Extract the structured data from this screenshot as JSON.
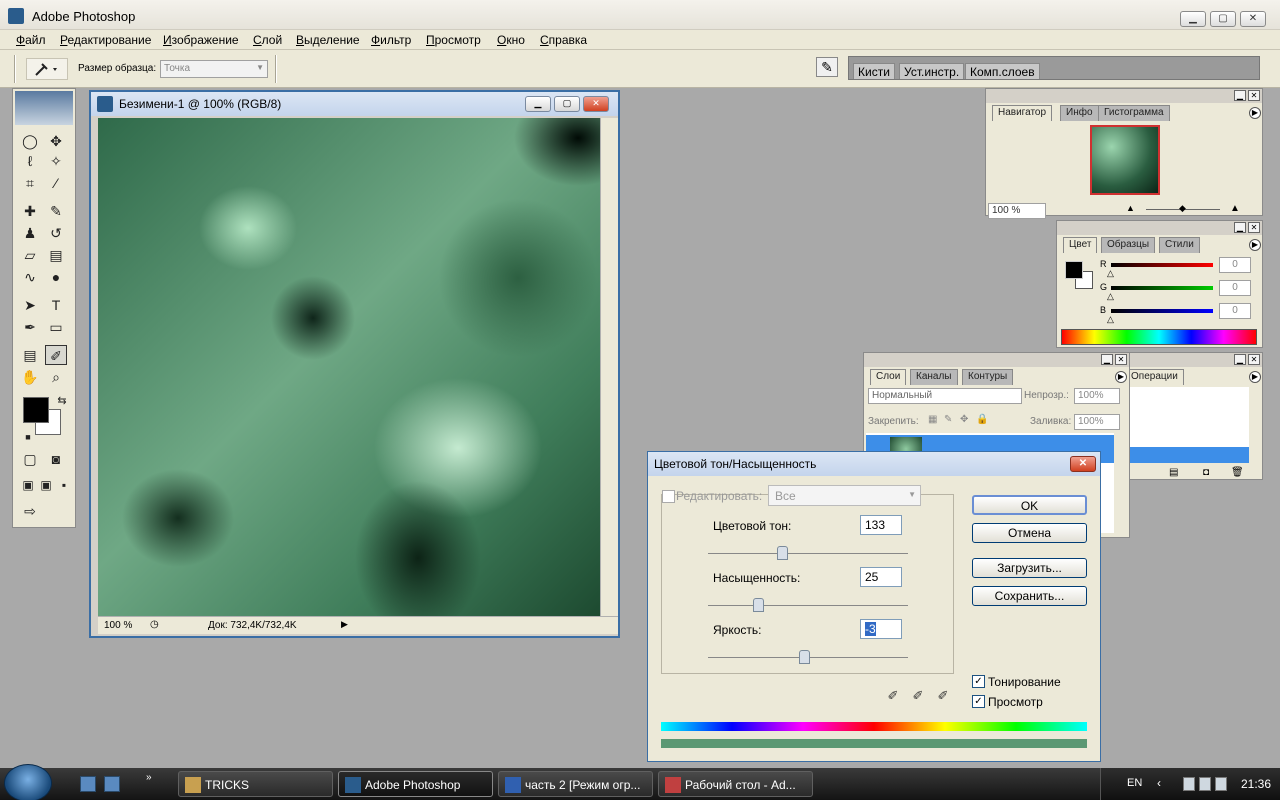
{
  "app": {
    "title": "Adobe Photoshop"
  },
  "menu": [
    "Файл",
    "Редактирование",
    "Изображение",
    "Слой",
    "Выделение",
    "Фильтр",
    "Просмотр",
    "Окно",
    "Справка"
  ],
  "options": {
    "sample_size_label": "Размер образца:",
    "sample_size_value": "Точка"
  },
  "well_tabs": [
    "Кисти",
    "Уст.инстр.",
    "Комп.слоев"
  ],
  "document": {
    "title": "Безимени-1 @ 100% (RGB/8)",
    "zoom": "100 %",
    "doc_size": "Док: 732,4K/732,4K"
  },
  "navigator": {
    "tabs": [
      "Навигатор",
      "Инфо",
      "Гистограмма"
    ],
    "zoom": "100 %"
  },
  "color_palette": {
    "tabs": [
      "Цвет",
      "Образцы",
      "Стили"
    ],
    "channels": [
      {
        "label": "R",
        "value": "0",
        "color": "#d01010"
      },
      {
        "label": "G",
        "value": "0",
        "color": "#10a010"
      },
      {
        "label": "B",
        "value": "0",
        "color": "#1010c0"
      }
    ]
  },
  "layers": {
    "tabs": [
      "Слои",
      "Каналы",
      "Контуры"
    ],
    "blend_mode": "Нормальный",
    "opacity_label": "Непрозр.:",
    "opacity": "100%",
    "lock_label": "Закрепить:",
    "fill_label": "Заливка:",
    "fill": "100%"
  },
  "history": {
    "tab": "Операции"
  },
  "hue_sat": {
    "title": "Цветовой тон/Насыщенность",
    "edit_label": "Редактировать:",
    "edit_value": "Все",
    "hue_label": "Цветовой тон:",
    "hue": "133",
    "hue_frac": 0.37,
    "saturation_label": "Насыщенность:",
    "saturation": "25",
    "sat_frac": 0.25,
    "lightness_label": "Яркость:",
    "lightness": "-3",
    "light_frac": 0.48,
    "ok": "OK",
    "cancel": "Отмена",
    "load": "Загрузить...",
    "save": "Сохранить...",
    "colorize_label": "Тонирование",
    "preview_label": "Просмотр",
    "colorize_checked": true,
    "preview_checked": true
  },
  "taskbar": {
    "buttons": [
      "TRICKS",
      "Adobe Photoshop",
      "часть 2 [Режим огр...",
      "Рабочий стол - Ad..."
    ],
    "language": "EN",
    "clock": "21:36"
  }
}
